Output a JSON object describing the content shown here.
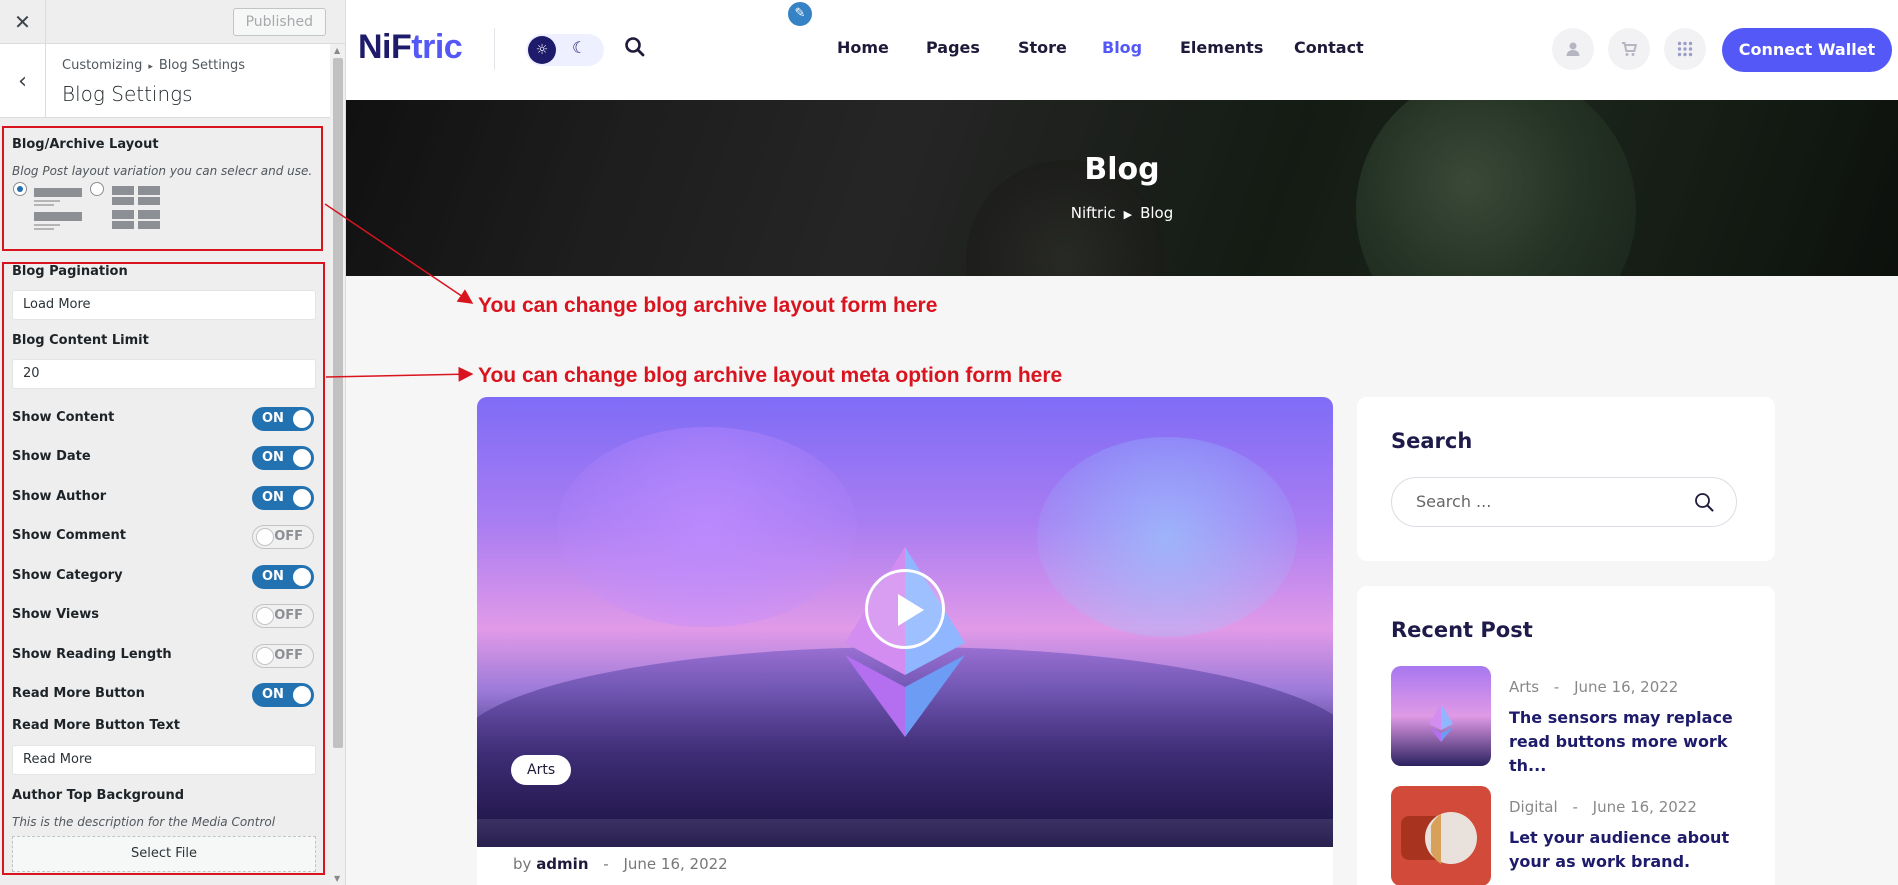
{
  "customizer": {
    "published_label": "Published",
    "breadcrumb_root": "Customizing",
    "breadcrumb_section": "Blog Settings",
    "title": "Blog Settings",
    "layout": {
      "label": "Blog/Archive Layout",
      "description": "Blog Post layout variation you can selecr and use.",
      "selected": 1
    },
    "pagination": {
      "label": "Blog Pagination",
      "value": "Load More"
    },
    "content_limit": {
      "label": "Blog Content Limit",
      "value": "20"
    },
    "toggles": [
      {
        "label": "Show Content",
        "state": "ON"
      },
      {
        "label": "Show Date",
        "state": "ON"
      },
      {
        "label": "Show Author",
        "state": "ON"
      },
      {
        "label": "Show Comment",
        "state": "OFF"
      },
      {
        "label": "Show Category",
        "state": "ON"
      },
      {
        "label": "Show Views",
        "state": "OFF"
      },
      {
        "label": "Show Reading Length",
        "state": "OFF"
      },
      {
        "label": "Read More Button",
        "state": "ON"
      }
    ],
    "read_more_text": {
      "label": "Read More Button Text",
      "value": "Read More"
    },
    "author_bg": {
      "label": "Author Top Background",
      "description": "This is the description for the Media Control",
      "button": "Select File"
    }
  },
  "annotations": {
    "layout_note": "You can change blog archive layout form here",
    "meta_note": "You can change blog archive layout meta option form here",
    "color": "#d9141e"
  },
  "site": {
    "logo_part1": "NiF",
    "logo_part2": "tric",
    "nav": [
      "Home",
      "Pages",
      "Store",
      "Blog",
      "Elements",
      "Contact"
    ],
    "active_nav": "Blog",
    "connect_label": "Connect Wallet",
    "accent": "#5458f7",
    "banner_title": "Blog",
    "banner_crumb_home": "Niftric",
    "banner_crumb_current": "Blog",
    "post": {
      "category": "Arts",
      "by": "by",
      "author": "admin",
      "date": "June 16, 2022"
    },
    "search_widget": {
      "title": "Search",
      "placeholder": "Search ..."
    },
    "recent_widget": {
      "title": "Recent Post",
      "items": [
        {
          "category": "Arts",
          "date": "June 16, 2022",
          "title": "The sensors may replace read buttons more work th..."
        },
        {
          "category": "Digital",
          "date": "June 16, 2022",
          "title": "Let your audience about your as work brand."
        }
      ]
    }
  }
}
